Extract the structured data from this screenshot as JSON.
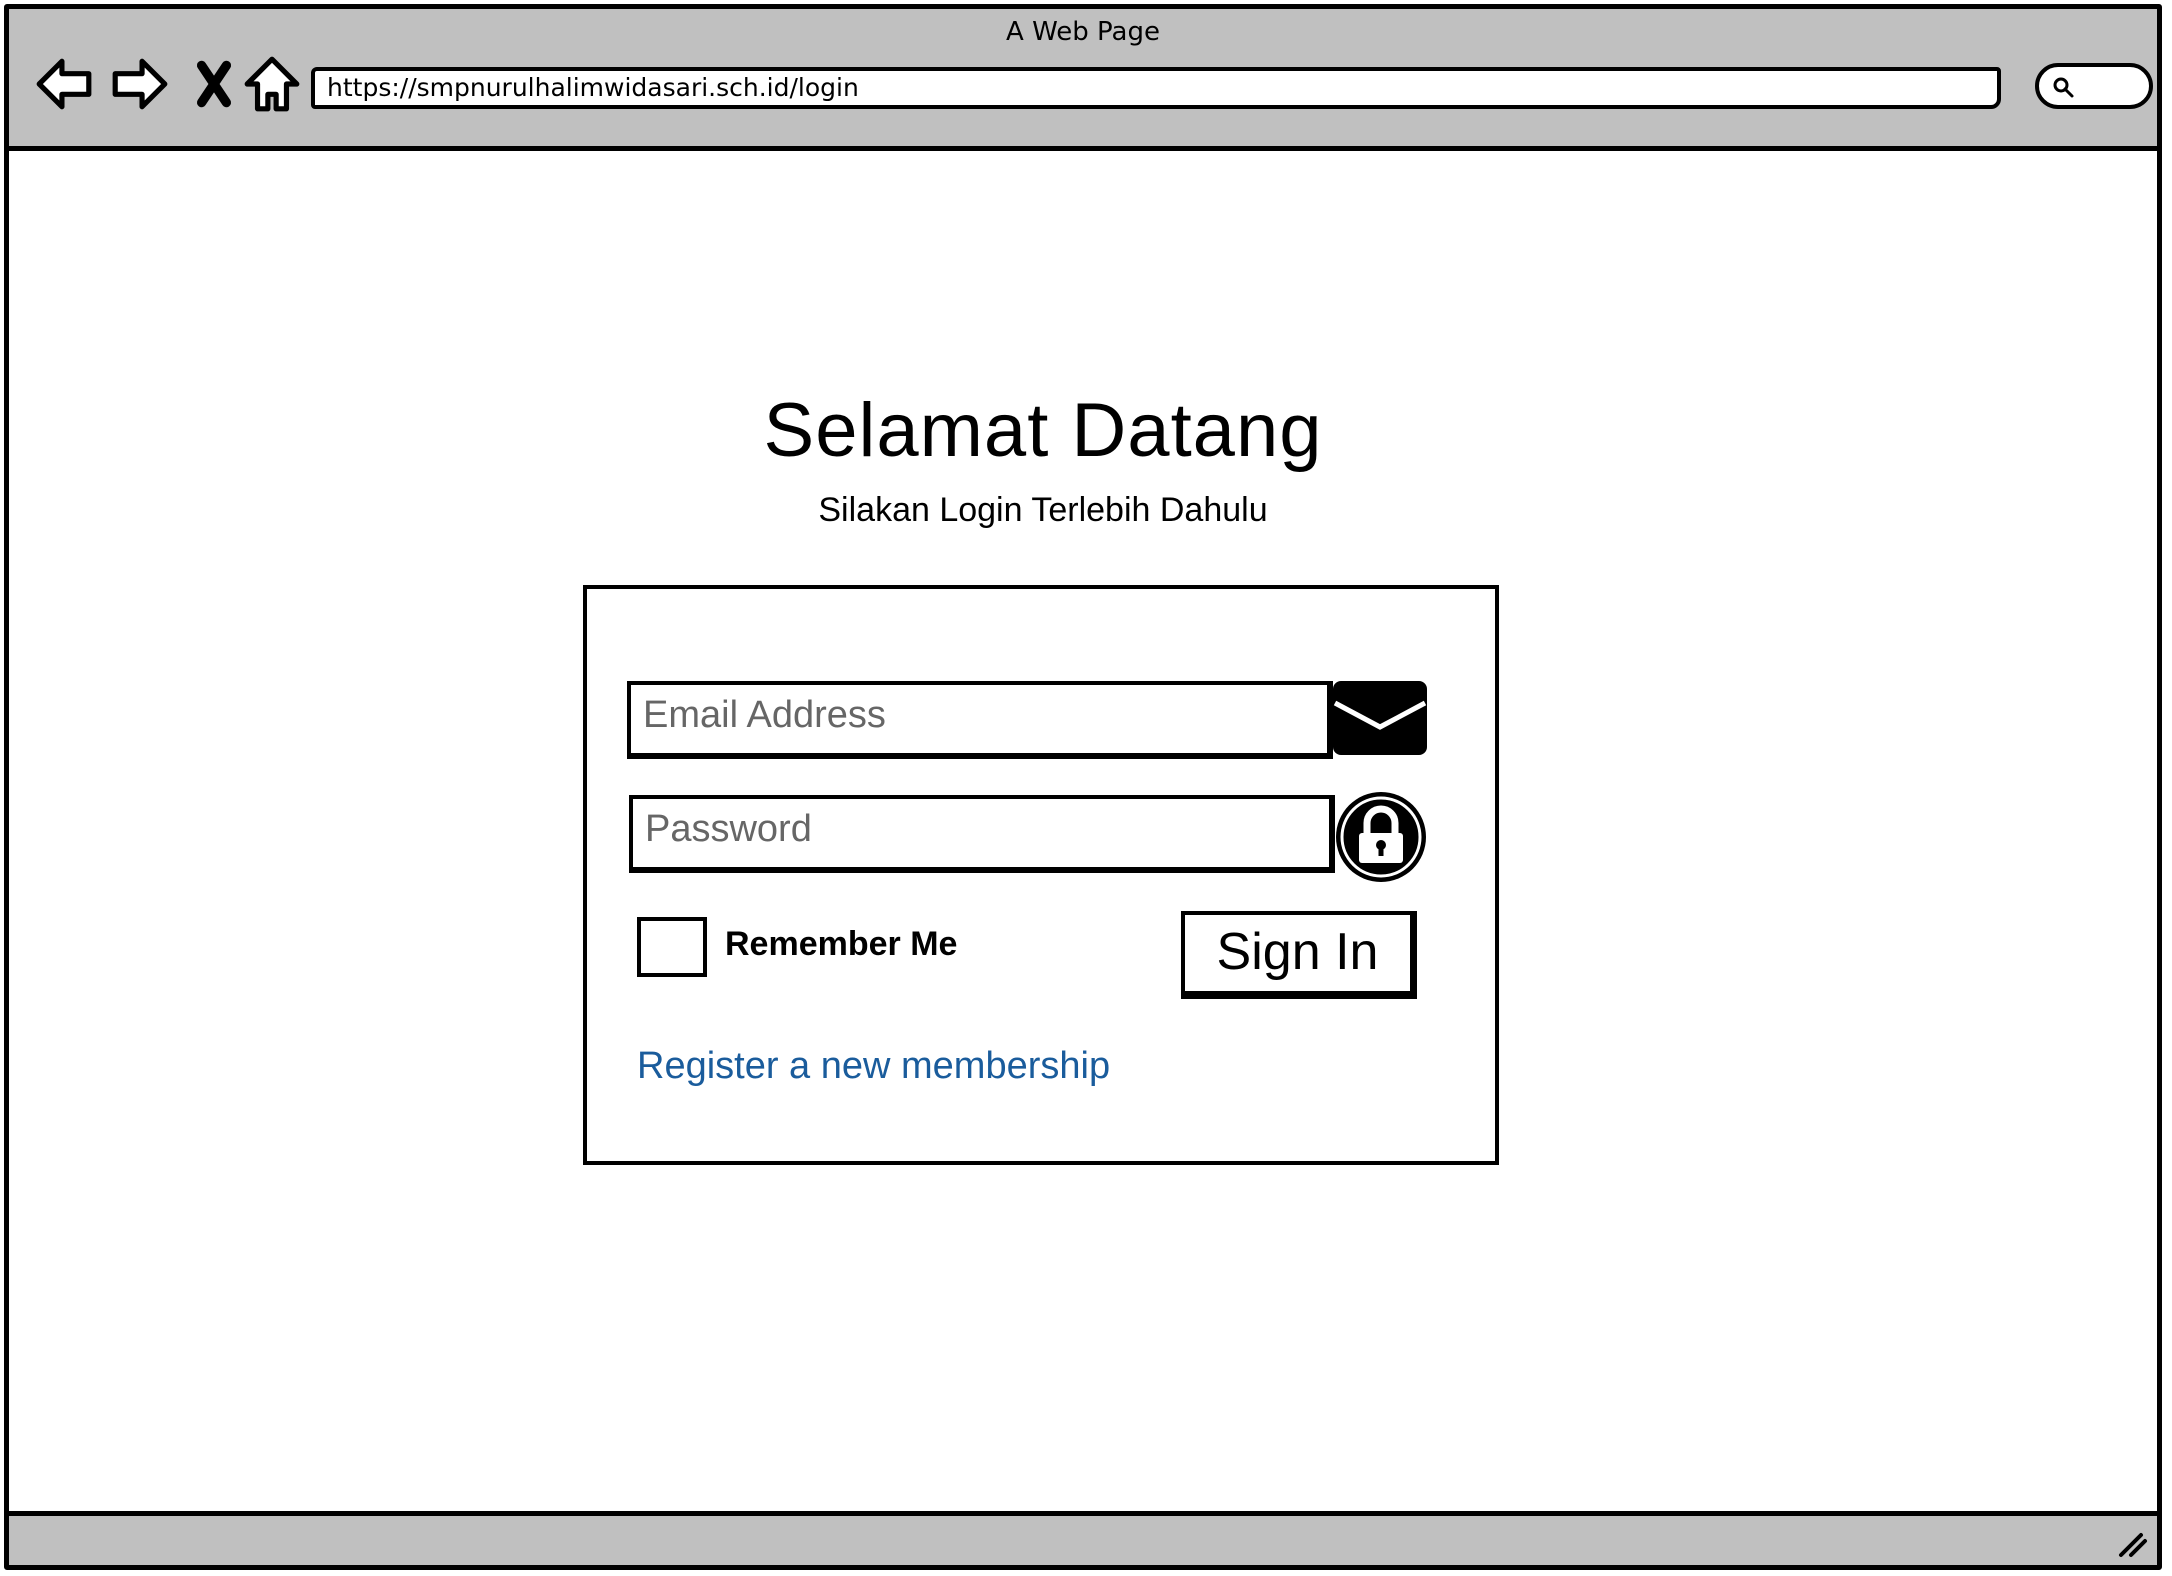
{
  "window": {
    "title": "A Web Page"
  },
  "toolbar": {
    "back_icon": "back-arrow-icon",
    "forward_icon": "forward-arrow-icon",
    "stop_icon": "close-x-icon",
    "home_icon": "home-icon",
    "url": "https://smpnurulhalimwidasari.sch.id/login",
    "search_icon": "search-icon"
  },
  "main": {
    "title": "Selamat Datang",
    "subtitle": "Silakan Login Terlebih Dahulu"
  },
  "login": {
    "email_placeholder": "Email Address",
    "email_icon": "envelope-icon",
    "password_placeholder": "Password",
    "password_icon": "lock-icon",
    "remember_label": "Remember Me",
    "remember_checked": false,
    "signin_label": "Sign In",
    "register_link": "Register a new membership",
    "link_color": "#1a5c9c"
  }
}
